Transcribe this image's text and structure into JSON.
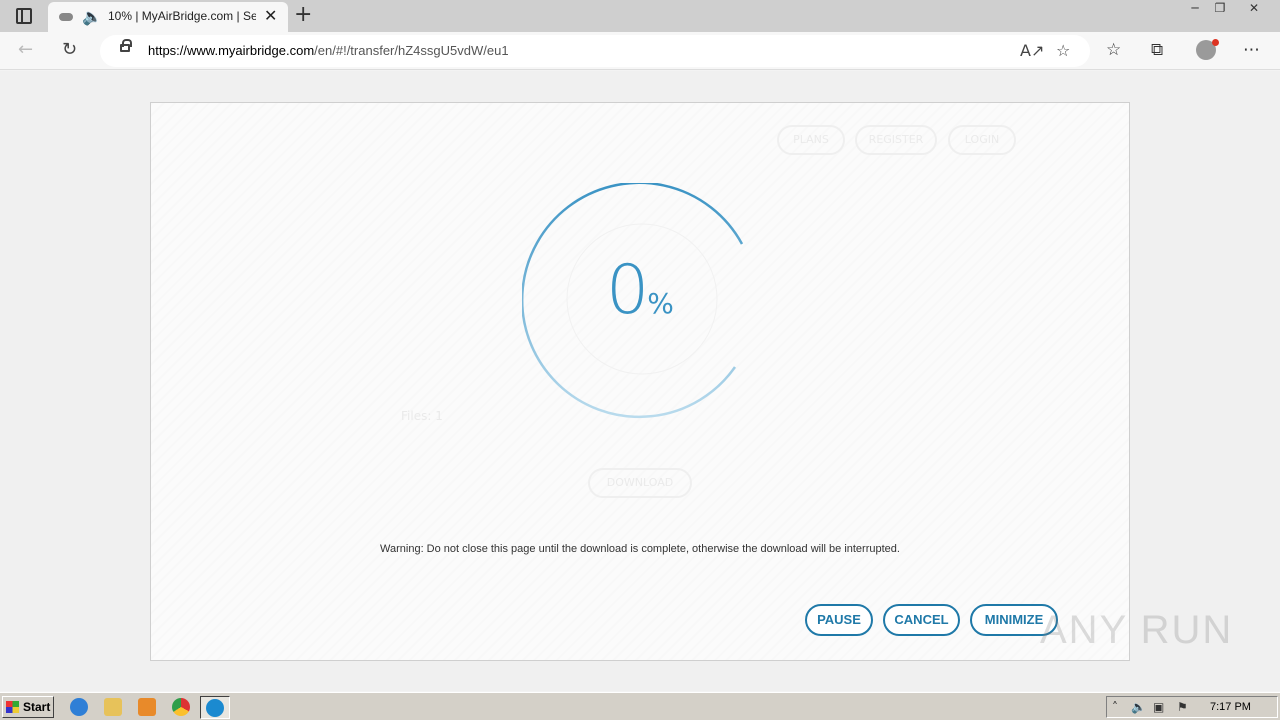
{
  "browser": {
    "tab_title": "10% | MyAirBridge.com | Se",
    "url_host": "https://www.myairbridge.com",
    "url_path": "/en/#!/transfer/hZ4ssgU5vdW/eu1"
  },
  "download": {
    "percent_value": "0",
    "percent_sign": "%",
    "warning": "Warning: Do not close this page until the download is complete, otherwise the download will be interrupted.",
    "pause_label": "PAUSE",
    "cancel_label": "CANCEL",
    "minimize_label": "MINIMIZE"
  },
  "background_page": {
    "nav_plans": "PLANS",
    "nav_register": "REGISTER",
    "nav_login": "LOGIN",
    "files_label": "Files: 1",
    "download_button": "DOWNLOAD"
  },
  "watermark": "ANY RUN",
  "taskbar": {
    "start_label": "Start",
    "clock": "7:17 PM"
  },
  "colors": {
    "accent": "#1f79a8",
    "progress": "#3a93c4"
  }
}
